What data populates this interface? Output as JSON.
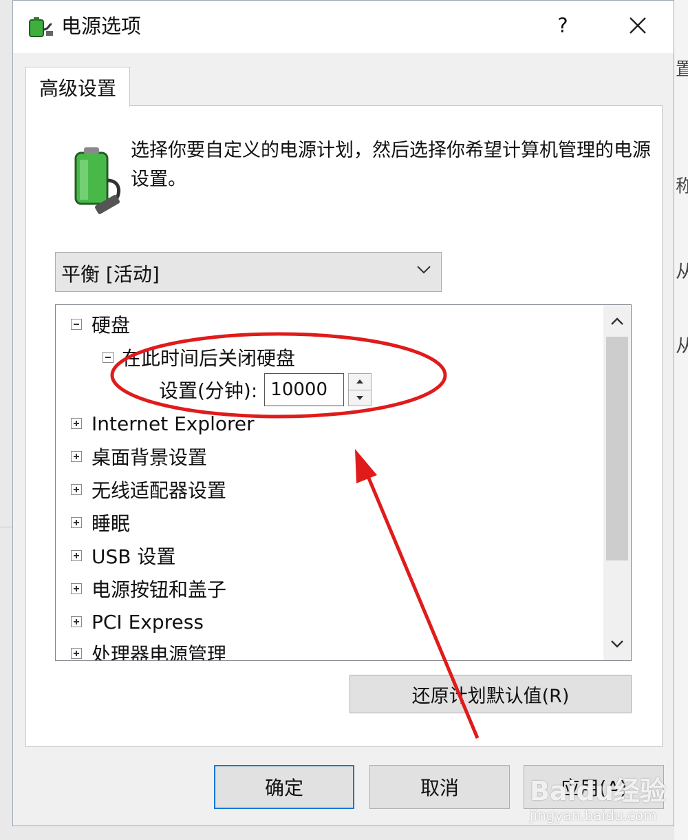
{
  "window": {
    "title": "电源选项",
    "help_label": "?",
    "icon": "power-options-icon",
    "close_icon": "close-icon"
  },
  "tabs": [
    {
      "label": "高级设置",
      "selected": true
    }
  ],
  "description": {
    "text": "选择你要自定义的电源计划，然后选择你希望计算机管理的电源设置。",
    "icon": "battery-plug-icon"
  },
  "plan_select": {
    "value": "平衡 [活动]"
  },
  "tree": {
    "items": [
      {
        "label": "硬盘",
        "expanded": true
      },
      {
        "label": "在此时间后关闭硬盘",
        "expanded": true,
        "level": 2
      },
      {
        "label": "Internet Explorer",
        "expanded": false
      },
      {
        "label": "桌面背景设置",
        "expanded": false
      },
      {
        "label": "无线适配器设置",
        "expanded": false
      },
      {
        "label": "睡眠",
        "expanded": false
      },
      {
        "label": "USB 设置",
        "expanded": false
      },
      {
        "label": "电源按钮和盖子",
        "expanded": false
      },
      {
        "label": "PCI Express",
        "expanded": false
      },
      {
        "label": "处理器电源管理",
        "expanded": false
      }
    ],
    "setting": {
      "label": "设置(分钟):",
      "value": "10000"
    }
  },
  "buttons": {
    "restore": "还原计划默认值(R)",
    "ok": "确定",
    "cancel": "取消",
    "apply": "应用(A)"
  },
  "annotation": {
    "color": "#e01b1b"
  },
  "watermark": {
    "logo": "Baidu经验",
    "url": "jingyan.baidu.com"
  }
}
